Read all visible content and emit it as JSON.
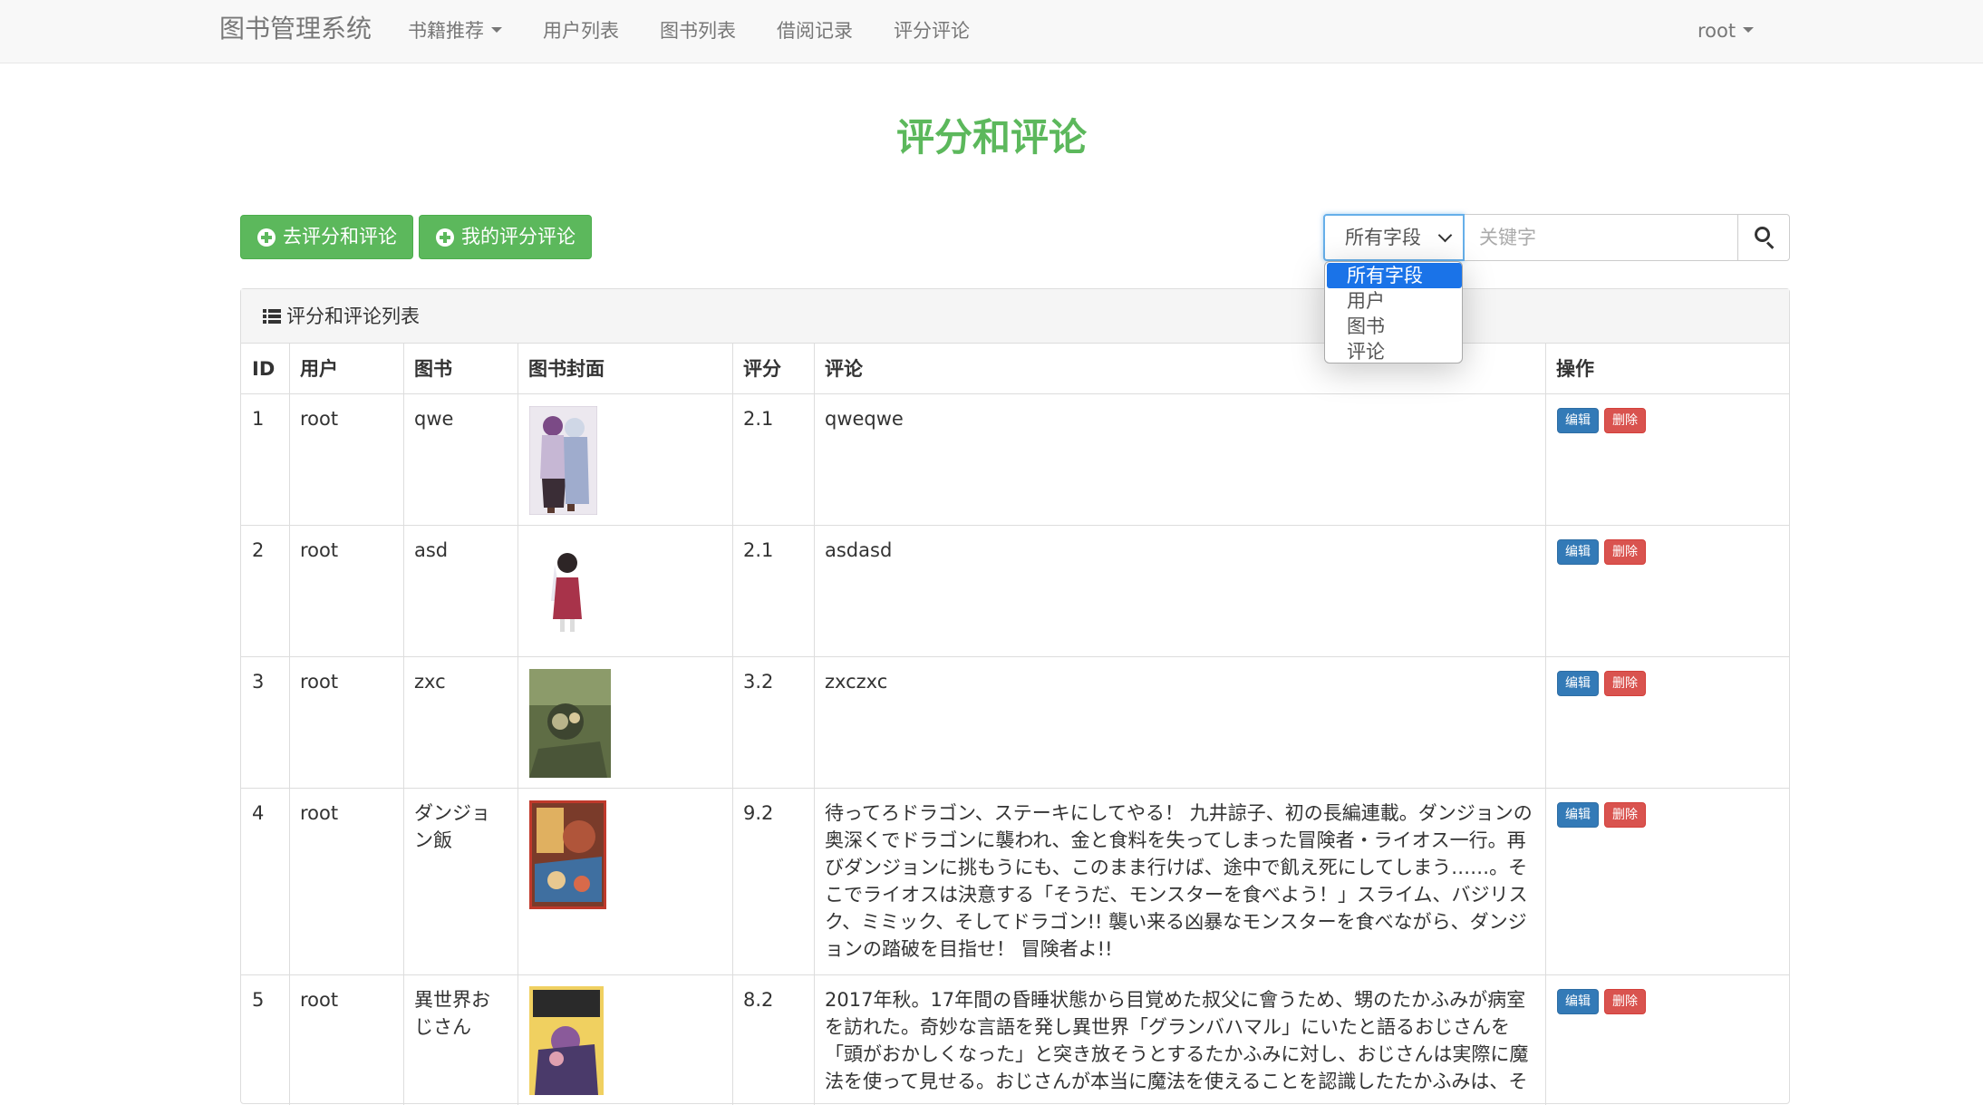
{
  "navbar": {
    "brand": "图书管理系统",
    "items": [
      "书籍推荐",
      "用户列表",
      "图书列表",
      "借阅记录",
      "评分评论"
    ],
    "user": "root"
  },
  "page_title": "评分和评论",
  "buttons": {
    "go_rate": "去评分和评论",
    "my_ratings": "我的评分评论"
  },
  "search": {
    "field_selected": "所有字段",
    "options": [
      "所有字段",
      "用户",
      "图书",
      "评论"
    ],
    "placeholder": "关键字"
  },
  "panel_title": "评分和评论列表",
  "table": {
    "headers": [
      "ID",
      "用户",
      "图书",
      "图书封面",
      "评分",
      "评论",
      "操作"
    ],
    "edit_label": "编辑",
    "delete_label": "删除",
    "rows": [
      {
        "id": "1",
        "user": "root",
        "book": "qwe",
        "rating": "2.1",
        "comment": "qweqwe"
      },
      {
        "id": "2",
        "user": "root",
        "book": "asd",
        "rating": "2.1",
        "comment": "asdasd"
      },
      {
        "id": "3",
        "user": "root",
        "book": "zxc",
        "rating": "3.2",
        "comment": "zxczxc"
      },
      {
        "id": "4",
        "user": "root",
        "book": "ダンジョン飯",
        "rating": "9.2",
        "comment": "待ってろドラゴン、ステーキにしてやる！ 九井諒子、初の長編連載。ダンジョンの奥深くでドラゴンに襲われ、金と食料を失ってしまった冒険者・ライオス一行。再びダンジョンに挑もうにも、このまま行けば、途中で飢え死にしてしまう……。そこでライオスは決意する「そうだ、モンスターを食べよう！」スライム、バジリスク、ミミック、そしてドラゴン!! 襲い来る凶暴なモンスターを食べながら、ダンジョンの踏破を目指せ！ 冒険者よ!!"
      },
      {
        "id": "5",
        "user": "root",
        "book": "異世界おじさん",
        "rating": "8.2",
        "comment": "2017年秋。17年間の昏睡状態から目覚めた叔父に會うため、甥のたかふみが病室を訪れた。奇妙な言語を発し異世界「グランバハマル」にいたと語るおじさんを「頭がおかしくなった」と突き放そうとするたかふみに対し、おじさんは実際に魔法を使って見せる。おじさんが本当に魔法を使えることを認識したたかふみは、そ"
      }
    ]
  },
  "colors": {
    "primary_green": "#5cb85c",
    "edit_blue": "#337ab7",
    "delete_red": "#d9534f",
    "dropdown_highlight": "#1a73e8"
  }
}
